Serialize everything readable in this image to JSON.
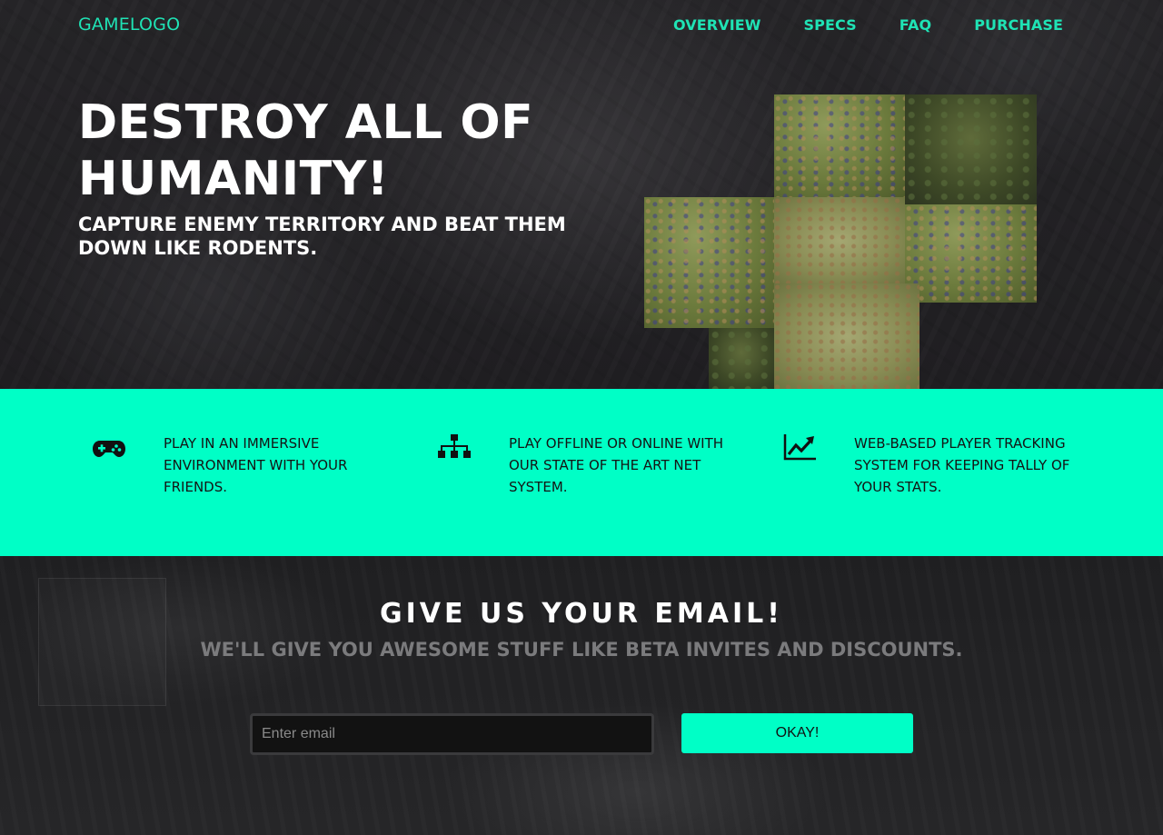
{
  "brand": {
    "logo_text": "GAMELOGO",
    "accent_color": "#00ffc6"
  },
  "nav": {
    "items": [
      {
        "label": "OVERVIEW"
      },
      {
        "label": "SPECS"
      },
      {
        "label": "FAQ"
      },
      {
        "label": "PURCHASE"
      }
    ]
  },
  "hero": {
    "headline": "DESTROY ALL OF HUMANITY!",
    "subheadline": "CAPTURE ENEMY TERRITORY AND BEAT THEM DOWN LIKE RODENTS."
  },
  "features": [
    {
      "icon": "gamepad-icon",
      "text": "PLAY IN AN IMMERSIVE ENVIRONMENT WITH YOUR FRIENDS."
    },
    {
      "icon": "network-icon",
      "text": "PLAY OFFLINE OR ONLINE WITH OUR STATE OF THE ART NET SYSTEM."
    },
    {
      "icon": "chart-trend-icon",
      "text": "WEB-BASED PLAYER TRACKING SYSTEM FOR KEEPING TALLY OF YOUR STATS."
    }
  ],
  "signup": {
    "title": "GIVE US YOUR EMAIL!",
    "subtitle": "WE'LL GIVE YOU AWESOME STUFF LIKE BETA INVITES AND DISCOUNTS.",
    "email_placeholder": "Enter email",
    "email_value": "",
    "button_label": "OKAY!"
  }
}
